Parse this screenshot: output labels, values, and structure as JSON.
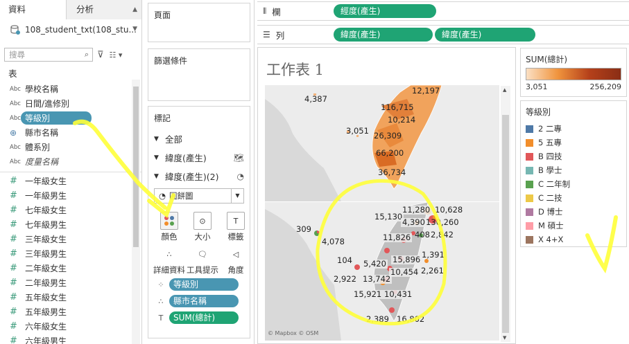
{
  "data_pane": {
    "tab_data": "資料",
    "tab_analytics": "分析",
    "datasource": "108_student_txt(108_stu...",
    "search_placeholder": "搜尋",
    "section_tables": "表",
    "fields": [
      {
        "type": "Abc",
        "name": "學校名稱"
      },
      {
        "type": "Abc",
        "name": "日間/進修別"
      },
      {
        "type": "Abc",
        "name": "等級別",
        "selected": true
      },
      {
        "type": "globe",
        "name": "縣市名稱"
      },
      {
        "type": "Abc",
        "name": "體系別"
      },
      {
        "type": "Abc",
        "name": "度量名稱",
        "italic": true
      }
    ],
    "measures": [
      "一年級女生",
      "一年級男生",
      "七年級女生",
      "七年級男生",
      "三年級女生",
      "三年級男生",
      "二年級女生",
      "二年級男生",
      "五年級女生",
      "五年級男生",
      "六年級女生",
      "六年級男生"
    ]
  },
  "pages_card": {
    "title": "頁面"
  },
  "filters_card": {
    "title": "篩選條件"
  },
  "marks_card": {
    "title": "標記",
    "all": "全部",
    "lat1": "緯度(產生)",
    "lat2": "緯度(產生)(2)",
    "mark_type": "圓餅圖",
    "buttons": [
      "顏色",
      "大小",
      "標籤",
      "詳細資料",
      "工具提示",
      "角度"
    ],
    "pills": [
      {
        "icon": "color",
        "label": "等級別",
        "style": "blue"
      },
      {
        "icon": "detail",
        "label": "縣市名稱",
        "style": "blue"
      },
      {
        "icon": "label",
        "label": "SUM(總計)",
        "style": "green"
      }
    ]
  },
  "shelves": {
    "columns_label": "欄",
    "columns_pills": [
      "經度(產生)"
    ],
    "rows_label": "列",
    "rows_pills": [
      "緯度(產生)",
      "緯度(產生)"
    ]
  },
  "worksheet": {
    "title": "工作表 1",
    "attribution": "© Mapbox © OSM",
    "top_labels": [
      "12,197",
      "4,387",
      "116,715",
      "10,214",
      "3,051",
      "26,309",
      "66,200",
      "36,734"
    ],
    "bottom_labels": [
      "11,280",
      "10,628",
      "15,130",
      "4,390",
      "130,260",
      "309",
      "408",
      "2,842",
      "11,826",
      "4,078",
      "1,391",
      "15,896",
      "104",
      "5,420",
      "2,261",
      "10,454",
      "2,922",
      "13,742",
      "15,921",
      "10,431",
      "2,389",
      "16,802"
    ]
  },
  "legend_sum": {
    "title": "SUM(總計)",
    "min": "3,051",
    "max": "256,209"
  },
  "legend_level": {
    "title": "等級別",
    "items": [
      {
        "label": "2 二專",
        "color": "#4e79a7"
      },
      {
        "label": "5 五專",
        "color": "#f28e2b"
      },
      {
        "label": "B 四技",
        "color": "#e15759"
      },
      {
        "label": "B 學士",
        "color": "#76b7b2"
      },
      {
        "label": "C 二年制",
        "color": "#59a14f"
      },
      {
        "label": "C 二技",
        "color": "#edc948"
      },
      {
        "label": "D 博士",
        "color": "#b07aa1"
      },
      {
        "label": "M 碩士",
        "color": "#ff9da7"
      },
      {
        "label": "X 4+X",
        "color": "#9c755f"
      }
    ]
  }
}
